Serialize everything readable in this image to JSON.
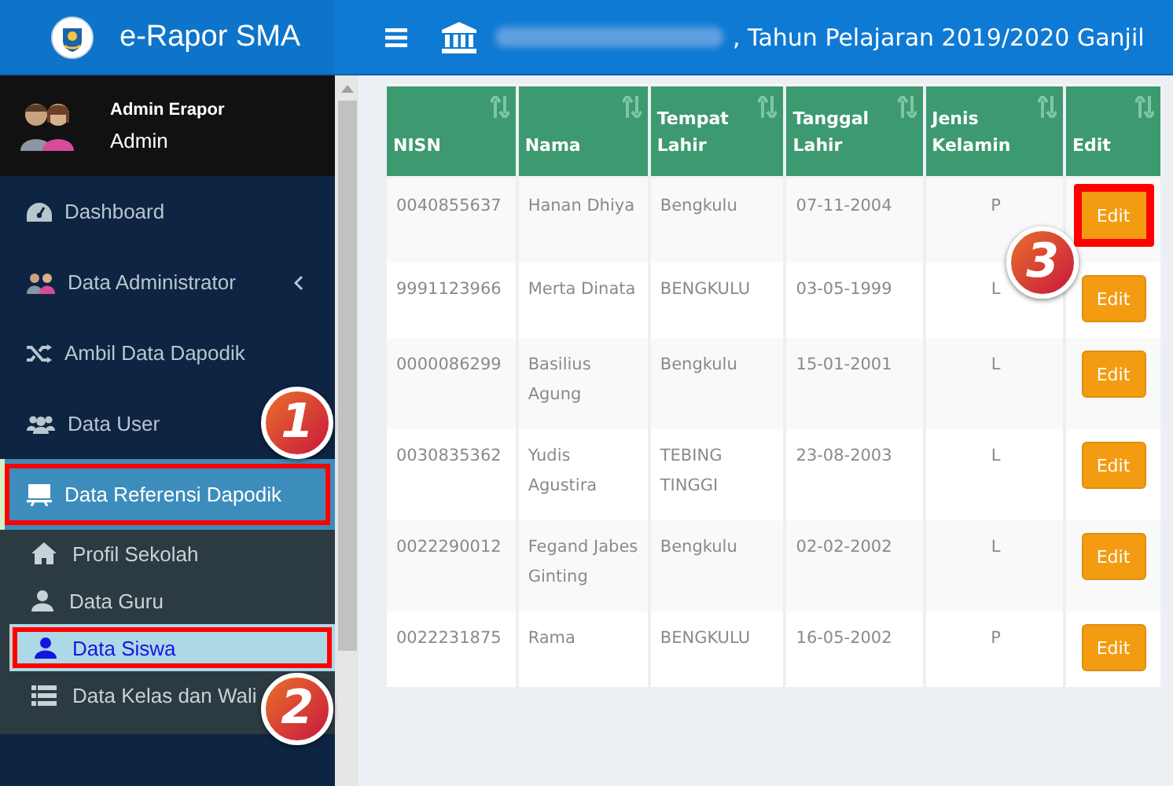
{
  "header": {
    "app_title": "e-Rapor SMA",
    "school_info": ", Tahun Pelajaran 2019/2020 Ganjil"
  },
  "user_panel": {
    "name": "Admin Erapor",
    "role": "Admin"
  },
  "sidebar": {
    "items": [
      {
        "label": "Dashboard",
        "selected": false,
        "outlined": false
      },
      {
        "label": "Data Administrator",
        "selected": false,
        "outlined": false,
        "expanded": false
      },
      {
        "label": "Ambil Data Dapodik",
        "selected": false,
        "outlined": false
      },
      {
        "label": "Data User",
        "selected": false,
        "outlined": false
      },
      {
        "label": "Data Referensi Dapodik",
        "selected": true,
        "outlined": true,
        "callout": "1",
        "expanded": true,
        "children": [
          {
            "label": "Profil Sekolah",
            "selected": false,
            "outlined": false
          },
          {
            "label": "Data Guru",
            "selected": false,
            "outlined": false
          },
          {
            "label": "Data Siswa",
            "selected": true,
            "outlined": true,
            "callout": "2"
          },
          {
            "label": "Data Kelas dan Wali",
            "selected": false,
            "outlined": false
          }
        ]
      }
    ]
  },
  "table": {
    "columns": [
      "NISN",
      "Nama",
      "Tempat Lahir",
      "Tanggal Lahir",
      "Jenis Kelamin",
      "Edit"
    ],
    "rows": [
      {
        "cells": [
          "0040855637",
          "Hanan Dhiya",
          "Bengkulu",
          "07-11-2004",
          "P"
        ],
        "button": "Edit",
        "outlined": true,
        "callout": "3"
      },
      {
        "cells": [
          "9991123966",
          "Merta Dinata",
          "BENGKULU",
          "03-05-1999",
          "L"
        ],
        "button": "Edit",
        "outlined": false
      },
      {
        "cells": [
          "0000086299",
          "Basilius Agung",
          "Bengkulu",
          "15-01-2001",
          "L"
        ],
        "button": "Edit",
        "outlined": false
      },
      {
        "cells": [
          "0030835362",
          "Yudis Agustira",
          "TEBING TINGGI",
          "23-08-2003",
          "L"
        ],
        "button": "Edit",
        "outlined": false
      },
      {
        "cells": [
          "0022290012",
          "Fegand Jabes Ginting",
          "Bengkulu",
          "02-02-2002",
          "L"
        ],
        "button": "Edit",
        "outlined": false
      },
      {
        "cells": [
          "0022231875",
          "Rama",
          "BENGKULU",
          "16-05-2002",
          "P"
        ],
        "button": "Edit",
        "outlined": false
      }
    ]
  }
}
